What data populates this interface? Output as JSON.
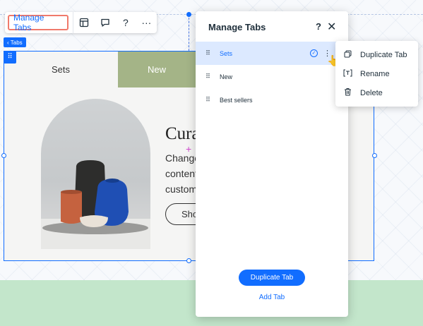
{
  "toolbar": {
    "manage_tabs_label": "Manage Tabs",
    "icons": [
      "layout-icon",
      "comment-icon",
      "help-icon",
      "more-icon"
    ],
    "help_glyph": "?",
    "more_glyph": "···"
  },
  "element_tag": {
    "label": "‹ Tabs"
  },
  "canvas": {
    "tabs": [
      {
        "label": "Sets"
      },
      {
        "label": "New"
      }
    ],
    "heading_fragment": "Cura",
    "body_lines": [
      "Change",
      "content",
      "custom"
    ],
    "button_fragment": "Sho"
  },
  "panel": {
    "title": "Manage Tabs",
    "help_glyph": "?",
    "close_glyph": "✕",
    "items": [
      {
        "label": "Sets",
        "selected": true
      },
      {
        "label": "New",
        "selected": false
      },
      {
        "label": "Best sellers",
        "selected": false
      }
    ],
    "primary_button": "Duplicate Tab",
    "secondary_link": "Add Tab"
  },
  "context_menu": {
    "items": [
      {
        "label": "Duplicate Tab",
        "icon": "duplicate-icon"
      },
      {
        "label": "Rename",
        "icon": "rename-icon"
      },
      {
        "label": "Delete",
        "icon": "trash-icon"
      }
    ]
  },
  "colors": {
    "accent": "#116dff",
    "selected_row_bg": "#dce9ff",
    "tab_new_bg": "#a4b487",
    "footer_band": "#c3e6cb",
    "highlight_border": "#f07a6b"
  }
}
